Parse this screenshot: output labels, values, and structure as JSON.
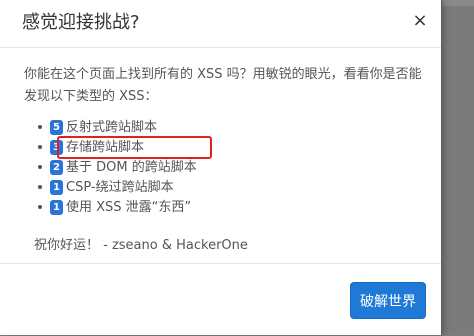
{
  "modal": {
    "title": "感觉迎接挑战?",
    "close_icon": "×",
    "intro": "你能在这个页面上找到所有的 XSS 吗？用敏锐的眼光，看看你是否能发现以下类型的 XSS：",
    "items": [
      {
        "badge": "5",
        "label": "反射式跨站脚本"
      },
      {
        "badge": "3",
        "label": "存储跨站脚本"
      },
      {
        "badge": "2",
        "label": "基于 DOM 的跨站脚本"
      },
      {
        "badge": "1",
        "label": "CSP-绕过跨站脚本"
      },
      {
        "badge": "1",
        "label": "使用 XSS 泄露“东西”"
      }
    ],
    "signoff": "祝你好运！ - zseano & HackerOne",
    "primary_button": "破解世界"
  },
  "colors": {
    "badge": "#2a74d8",
    "highlight_border": "#e0211c",
    "primary_button": "#1e7ad6"
  }
}
